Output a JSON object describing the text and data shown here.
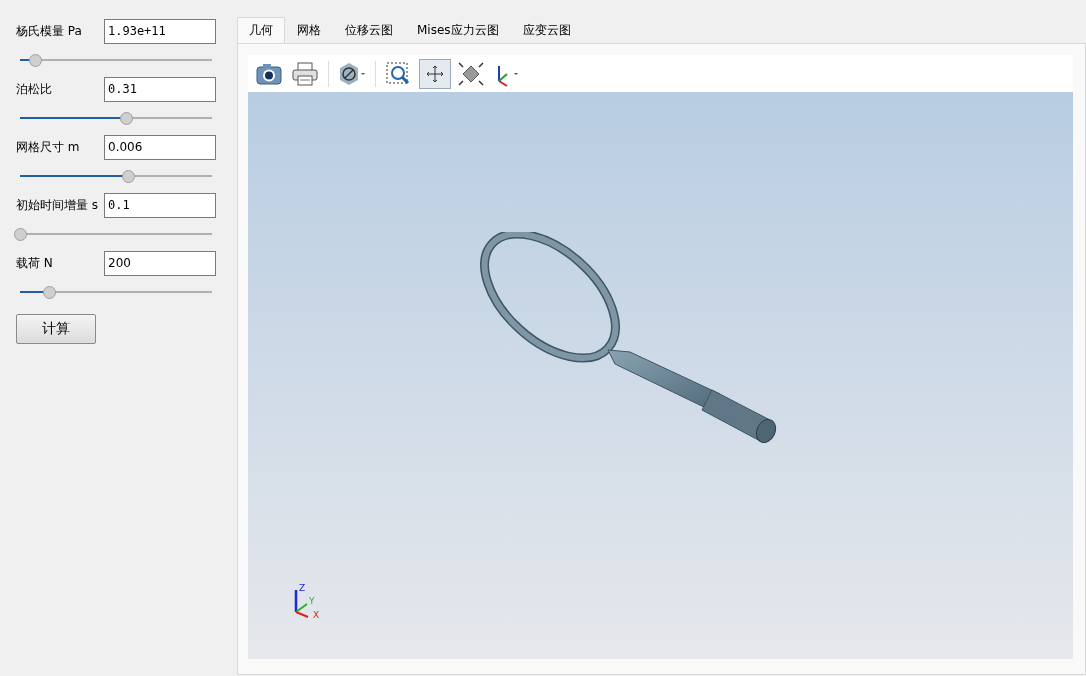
{
  "parameters": [
    {
      "label": "杨氏模量 Pa",
      "value": "1.93e+11",
      "mono": true,
      "level": 0.08
    },
    {
      "label": "泊松比",
      "value": "0.31",
      "mono": true,
      "level": 0.55
    },
    {
      "label": "网格尺寸 m",
      "value": "0.006",
      "mono": false,
      "level": 0.56
    },
    {
      "label": "初始时间增量 s",
      "value": "0.1",
      "mono": true,
      "level": 0.0
    },
    {
      "label": "载荷 N",
      "value": "200",
      "mono": false,
      "level": 0.15
    }
  ],
  "compute_button": "计算",
  "tabs": [
    {
      "label": "几何",
      "selected": true
    },
    {
      "label": "网格",
      "selected": false
    },
    {
      "label": "位移云图",
      "selected": false
    },
    {
      "label": "Mises应力云图",
      "selected": false
    },
    {
      "label": "应变云图",
      "selected": false
    }
  ],
  "toolbar": [
    {
      "kind": "camera",
      "pressed": false
    },
    {
      "kind": "print",
      "pressed": false
    },
    {
      "kind": "separator"
    },
    {
      "kind": "display",
      "pressed": false
    },
    {
      "kind": "separator"
    },
    {
      "kind": "zoom-box",
      "pressed": false
    },
    {
      "kind": "pan",
      "pressed": true
    },
    {
      "kind": "fit",
      "pressed": false
    },
    {
      "kind": "axes",
      "pressed": false
    }
  ],
  "axis_triad": {
    "x": "X",
    "y": "Y",
    "z": "Z"
  }
}
